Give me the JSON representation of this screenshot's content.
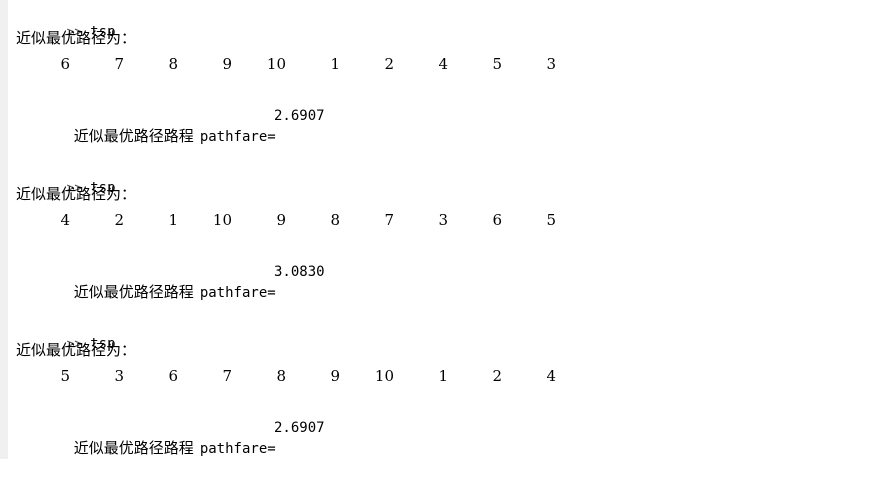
{
  "console": {
    "runs": [
      {
        "prompt": ">>",
        "command": "tsp",
        "path_label": "近似最优路径为：",
        "path": [
          "6",
          "7",
          "8",
          "9",
          "10",
          "1",
          "2",
          "4",
          "5",
          "3"
        ],
        "result_label": "近似最优路径路程",
        "result_var": "pathfare=",
        "result_value": "2.6907"
      },
      {
        "prompt": ">>",
        "command": "tsp",
        "path_label": "近似最优路径为：",
        "path": [
          "4",
          "2",
          "1",
          "10",
          "9",
          "8",
          "7",
          "3",
          "6",
          "5"
        ],
        "result_label": "近似最优路径路程",
        "result_var": "pathfare=",
        "result_value": "3.0830"
      },
      {
        "prompt": ">>",
        "command": "tsp",
        "path_label": "近似最优路径为：",
        "path": [
          "5",
          "3",
          "6",
          "7",
          "8",
          "9",
          "10",
          "1",
          "2",
          "4"
        ],
        "result_label": "近似最优路径路程",
        "result_var": "pathfare=",
        "result_value": "2.6907"
      }
    ]
  }
}
